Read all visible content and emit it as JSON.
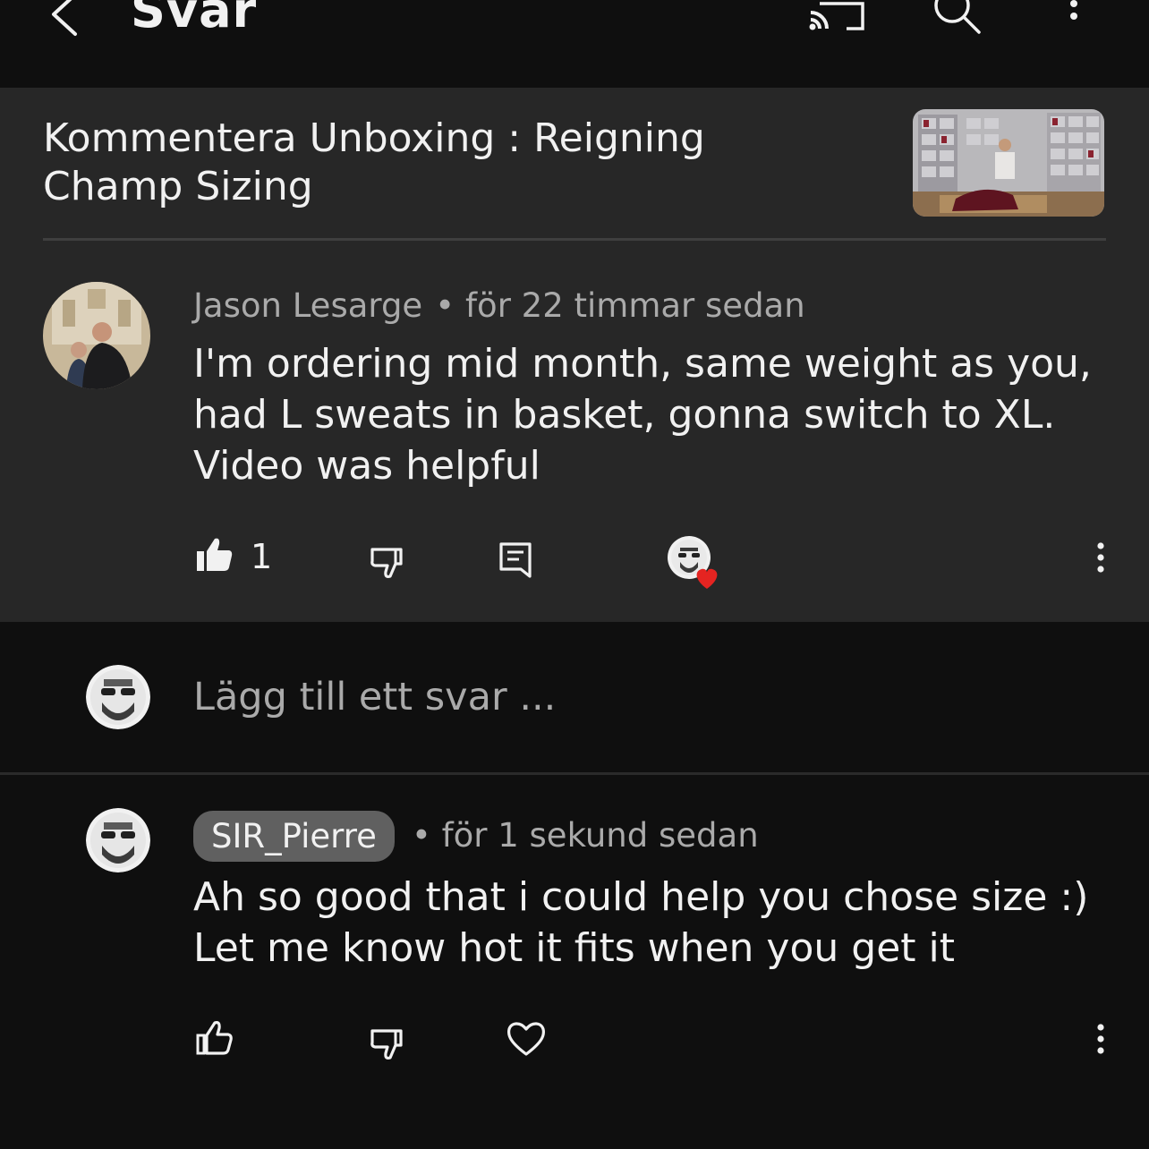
{
  "header": {
    "title": "Svar",
    "icons": [
      "back-arrow-icon",
      "cast-icon",
      "search-icon",
      "more-vert-icon"
    ]
  },
  "video": {
    "comment_title": "Kommentera Unboxing : Reigning Champ Sizing"
  },
  "comment": {
    "author": "Jason Lesarge",
    "separator": "•",
    "time": "för 22 timmar sedan",
    "text": "I'm ordering mid month, same weight as you, had L sweats in basket, gonna switch to XL. Video was helpful",
    "like_count": "1"
  },
  "reply_input": {
    "placeholder": "Lägg till ett svar ..."
  },
  "reply": {
    "author": "SIR_Pierre",
    "separator": "•",
    "time": "för 1 sekund sedan",
    "text": "Ah so good that i could help you chose size :) Let me know hot it fits when you get it"
  },
  "colors": {
    "background": "#0f0f0f",
    "panel": "#272727",
    "text_primary": "#f1f1f1",
    "text_secondary": "#aaaaaa",
    "author_pill": "#606060",
    "heart": "#e52421"
  }
}
